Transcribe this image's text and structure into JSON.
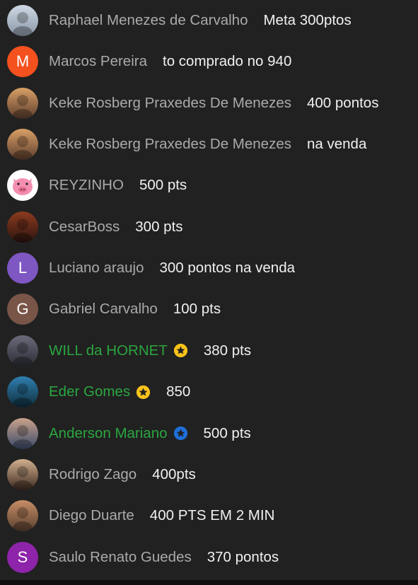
{
  "messages": [
    {
      "author": "Raphael Menezes de Carvalho",
      "text": "Meta 300ptos",
      "avatar": {
        "type": "photo",
        "icon": "photo-icon",
        "colors": [
          "#cfd8e3",
          "#8a98a8"
        ]
      },
      "member": false
    },
    {
      "author": "Marcos Pereira",
      "text": "to comprado no 940",
      "avatar": {
        "type": "letter",
        "letter": "M",
        "color": "#f4511e"
      },
      "member": false
    },
    {
      "author": "Keke Rosberg Praxedes De Menezes",
      "text": "400 pontos",
      "avatar": {
        "type": "photo",
        "icon": "photo-icon",
        "colors": [
          "#d9a066",
          "#5c3d2e"
        ]
      },
      "member": false
    },
    {
      "author": "Keke Rosberg Praxedes De Menezes",
      "text": "na venda",
      "avatar": {
        "type": "photo",
        "icon": "photo-icon",
        "colors": [
          "#d9a066",
          "#5c3d2e"
        ]
      },
      "member": false
    },
    {
      "author": "REYZINHO",
      "text": "500 pts",
      "avatar": {
        "type": "photo",
        "icon": "pig-icon",
        "colors": [
          "#ffffff",
          "#f48fb1"
        ]
      },
      "member": false
    },
    {
      "author": "CesarBoss",
      "text": "300 pts",
      "avatar": {
        "type": "photo",
        "icon": "photo-icon",
        "colors": [
          "#8d3b1e",
          "#2b1410"
        ]
      },
      "member": false
    },
    {
      "author": "Luciano araujo",
      "text": "300 pontos na venda",
      "avatar": {
        "type": "letter",
        "letter": "L",
        "color": "#7e57c2"
      },
      "member": false
    },
    {
      "author": "Gabriel Carvalho",
      "text": "100 pts",
      "avatar": {
        "type": "letter",
        "letter": "G",
        "color": "#795548"
      },
      "member": false
    },
    {
      "author": "WILL da HORNET",
      "text": "380 pts",
      "avatar": {
        "type": "photo",
        "icon": "photo-icon",
        "colors": [
          "#6b6b7a",
          "#2c2c36"
        ]
      },
      "member": true,
      "badge": {
        "icon": "star-badge-icon",
        "color": "#f9c21b"
      }
    },
    {
      "author": "Eder Gomes",
      "text": "850",
      "avatar": {
        "type": "photo",
        "icon": "photo-icon",
        "colors": [
          "#2f7fb0",
          "#0f2e3c"
        ]
      },
      "member": true,
      "badge": {
        "icon": "star-badge-icon",
        "color": "#f9c21b"
      }
    },
    {
      "author": "Anderson Mariano",
      "text": "500 pts",
      "avatar": {
        "type": "photo",
        "icon": "photo-icon",
        "colors": [
          "#c9a28a",
          "#3a4a6a"
        ]
      },
      "member": true,
      "badge": {
        "icon": "star-badge-icon",
        "color": "#1e6fd9"
      }
    },
    {
      "author": "Rodrigo Zago",
      "text": "400pts",
      "avatar": {
        "type": "photo",
        "icon": "photo-icon",
        "colors": [
          "#d2b08f",
          "#3d2a20"
        ]
      },
      "member": false
    },
    {
      "author": "Diego Duarte",
      "text": "400 PTS EM 2 MIN",
      "avatar": {
        "type": "photo",
        "icon": "photo-icon",
        "colors": [
          "#c68d66",
          "#5a4030"
        ]
      },
      "member": false
    },
    {
      "author": "Saulo Renato Guedes",
      "text": "370 pontos",
      "avatar": {
        "type": "letter",
        "letter": "S",
        "color": "#8e24aa"
      },
      "member": false
    }
  ],
  "colors": {
    "background": "#212121",
    "author_text": "#aaaaaa",
    "member_author_text": "#2ba640",
    "message_text": "#f1f1f1"
  }
}
